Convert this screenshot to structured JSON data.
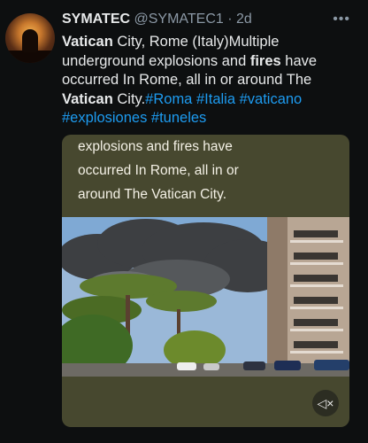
{
  "tweet": {
    "display_name": "SYMATEC",
    "handle": "@SYMATEC1",
    "separator": "·",
    "time": "2d",
    "more_icon": "more-icon",
    "text_segments": [
      {
        "text": "Vatican",
        "style": "bold"
      },
      {
        "text": " City, Rome (Italy)Multiple underground explosions and ",
        "style": "normal"
      },
      {
        "text": "fires",
        "style": "bold"
      },
      {
        "text": " have occurred In Rome, all in or around The ",
        "style": "normal"
      },
      {
        "text": "Vatican",
        "style": "bold"
      },
      {
        "text": " City.",
        "style": "normal"
      }
    ],
    "hashtags": [
      "#Roma",
      "#Italia",
      "#vaticano",
      "#explosiones",
      "#tuneles"
    ]
  },
  "media": {
    "caption_lines": [
      "explosions and fires have",
      "occurred In Rome, all in or",
      "around The Vatican City."
    ],
    "mute_icon": "mute-icon"
  },
  "colors": {
    "link": "#1d9bf0",
    "background": "#0d0f10",
    "media_bg": "#47482f",
    "muted_text": "#8b98a5"
  }
}
